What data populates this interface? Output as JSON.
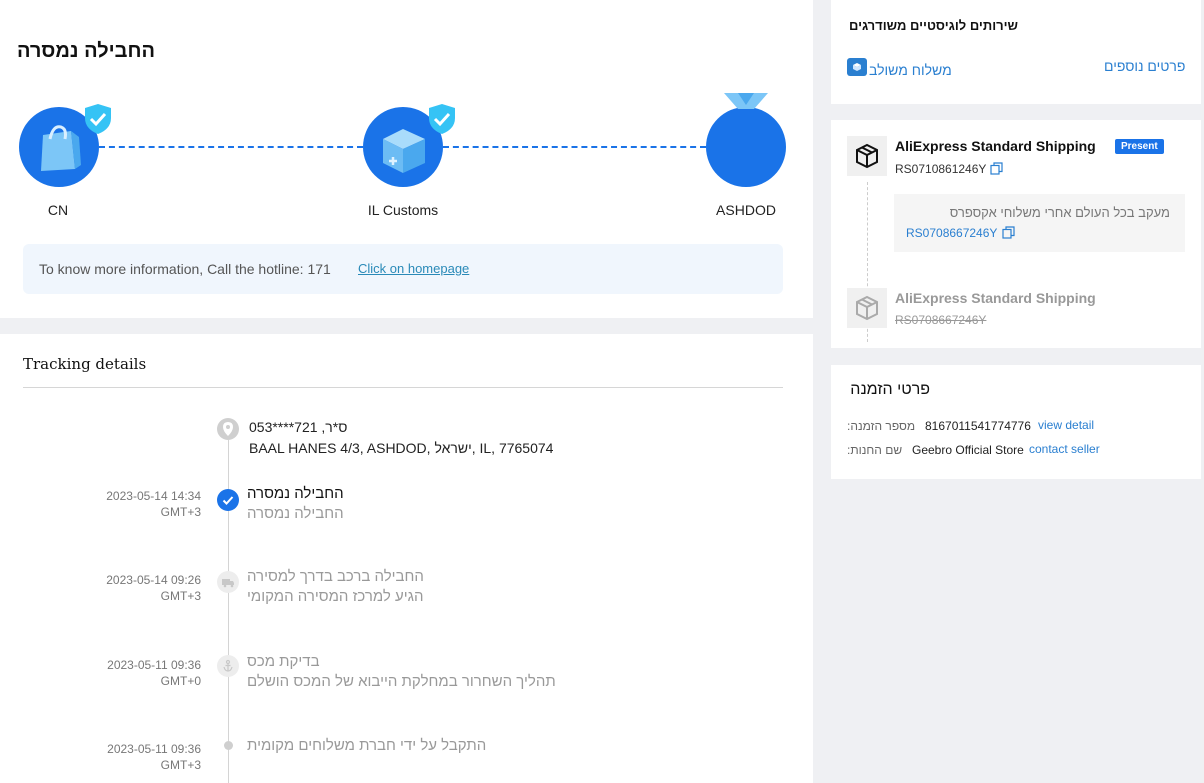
{
  "status": {
    "title": "החבילה נמסרה",
    "nodes": [
      {
        "label": "CN",
        "icon": "shopping-bag-icon",
        "verified": true
      },
      {
        "label": "IL Customs",
        "icon": "customs-box-icon",
        "verified": true
      },
      {
        "label": "ASHDOD",
        "icon": "delivery-pin-icon",
        "verified": false
      }
    ],
    "hotline_text": "To know more information, Call the hotline: 171",
    "homepage_link": "Click on homepage"
  },
  "tracking": {
    "heading": "Tracking details",
    "address": {
      "line1": "ס*ר,  721****053",
      "line2": "BAAL HANES 4/3,  ASHDOD,  ישראל,  IL,  7765074"
    },
    "events": [
      {
        "date": "2023-05-14 14:34",
        "tz": "GMT+3",
        "title": "החבילה נמסרה",
        "sub": "החבילה נמסרה",
        "icon": "check-icon",
        "active": true
      },
      {
        "date": "2023-05-14 09:26",
        "tz": "GMT+3",
        "title": "החבילה ברכב בדרך למסירה",
        "sub": "הגיע למרכז המסירה המקומי",
        "icon": "truck-icon",
        "active": false
      },
      {
        "date": "2023-05-11 09:36",
        "tz": "GMT+0",
        "title": "בדיקת מכס",
        "sub": "תהליך השחרור במחלקת הייבוא של המכס הושלם",
        "icon": "anchor-icon",
        "active": false
      },
      {
        "date": "2023-05-11 09:36",
        "tz": "GMT+3",
        "title": "התקבל על ידי חברת משלוחים מקומית",
        "sub": "",
        "icon": "dot-icon",
        "active": false
      }
    ]
  },
  "logistics": {
    "title": "שירותים לוגיסטיים משודרגים",
    "combined_link": "משלוח משולב",
    "more_link": "פרטים נוספים"
  },
  "shipping": {
    "primary_name": "AliExpress Standard Shipping",
    "primary_badge": "Present",
    "primary_code": "RS0710861246Y",
    "track_note": "מעקב בכל העולם אחרי משלוחי אקספרס",
    "track_code": "RS0708667246Y",
    "secondary_name": "AliExpress Standard Shipping",
    "secondary_code": "RS0708667246Y"
  },
  "order": {
    "title": "פרטי הזמנה",
    "number_label": "מספר הזמנה:",
    "number": "8167011541774776",
    "view_detail": "view detail",
    "store_label": "שם החנות:",
    "store": "Geebro Official Store",
    "contact": "contact seller"
  },
  "colors": {
    "accent": "#1a73e8",
    "badge": "#35c3f5",
    "link": "#2a7fd0",
    "page_bg": "#eff0f3"
  }
}
